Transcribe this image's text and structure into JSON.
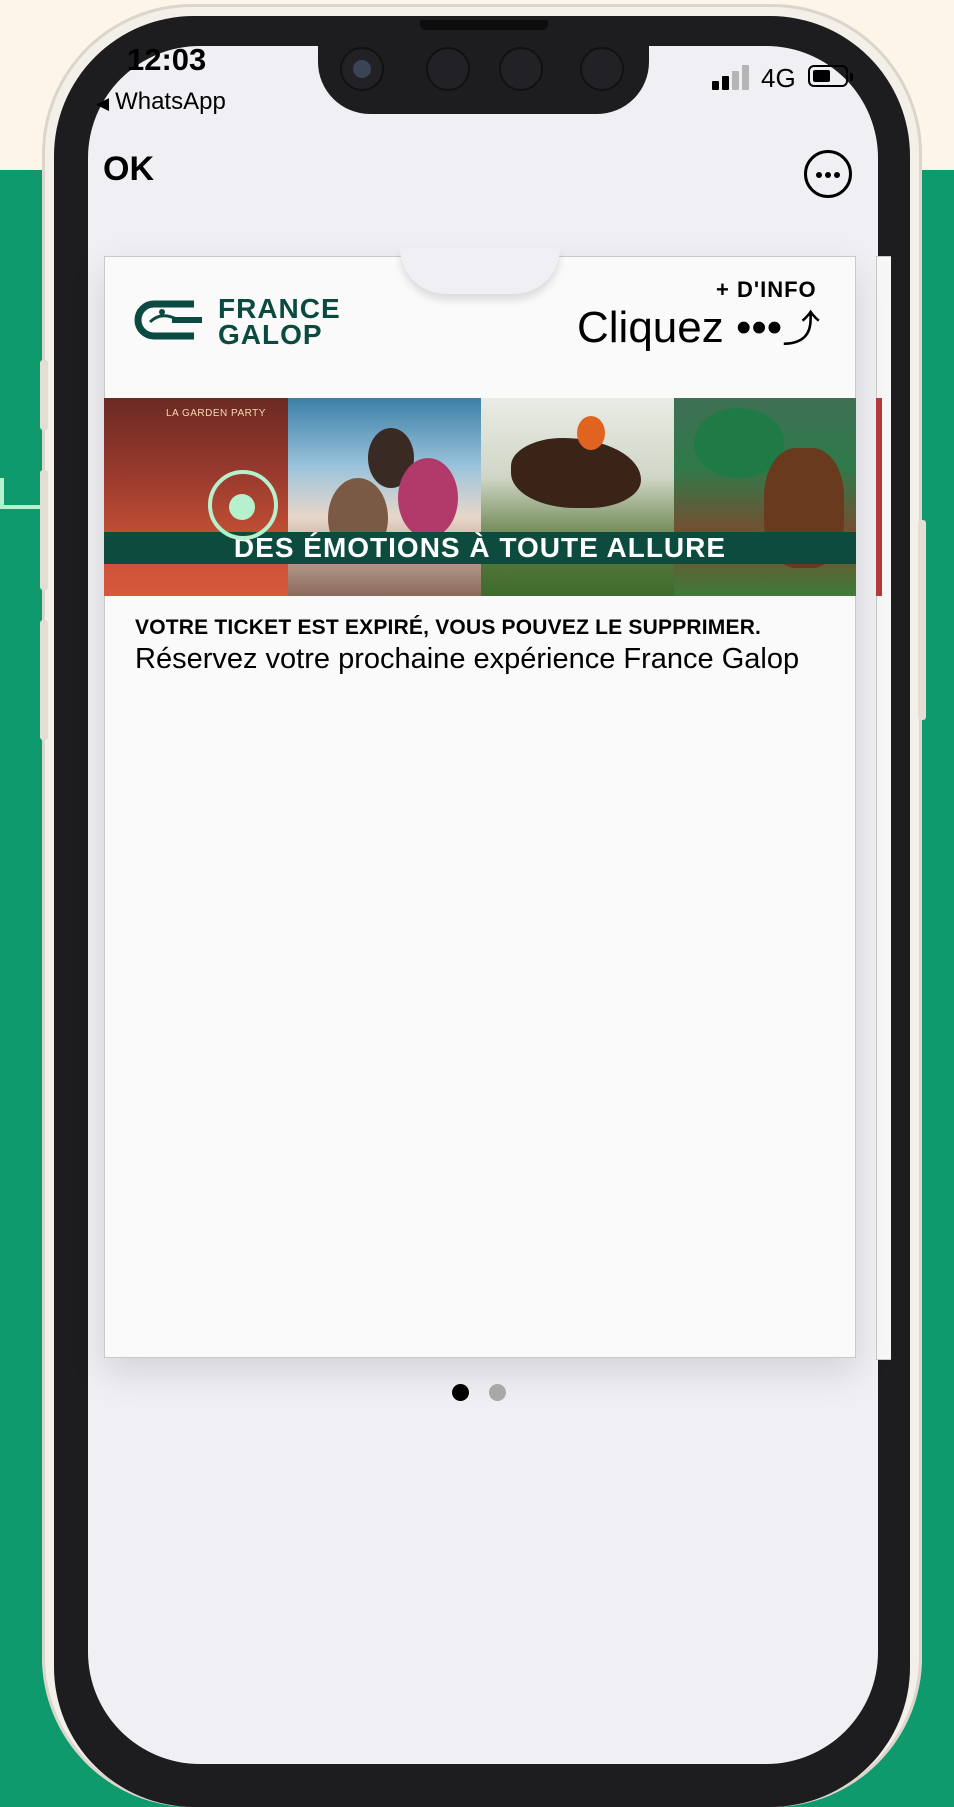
{
  "status_bar": {
    "time": "12:03",
    "back_app": "WhatsApp",
    "network": "4G",
    "battery_level": 0.55
  },
  "nav": {
    "ok_label": "OK",
    "more_icon": "ellipsis-circle-icon"
  },
  "card": {
    "logo_line1": "FRANCE",
    "logo_line2": "GALOP",
    "info_label": "+ D'INFO",
    "info_value": "Cliquez •••",
    "info_arrow": "⤴",
    "banner_slogan": "DES ÉMOTIONS À TOUTE ALLURE",
    "banner_panel1_label": "LA GARDEN PARTY",
    "expired_notice": "VOTRE TICKET EST EXPIRÉ, VOUS POUVEZ LE SUPPRIMER.",
    "reserve_text": "Réservez votre prochaine expérience France Galop"
  },
  "pagination": {
    "current": 1,
    "total": 2
  },
  "colors": {
    "background_green": "#0f9a6e",
    "background_cream": "#fdf5e8",
    "brand_green": "#0b4a40",
    "callout_mint": "#b7f0cd"
  }
}
